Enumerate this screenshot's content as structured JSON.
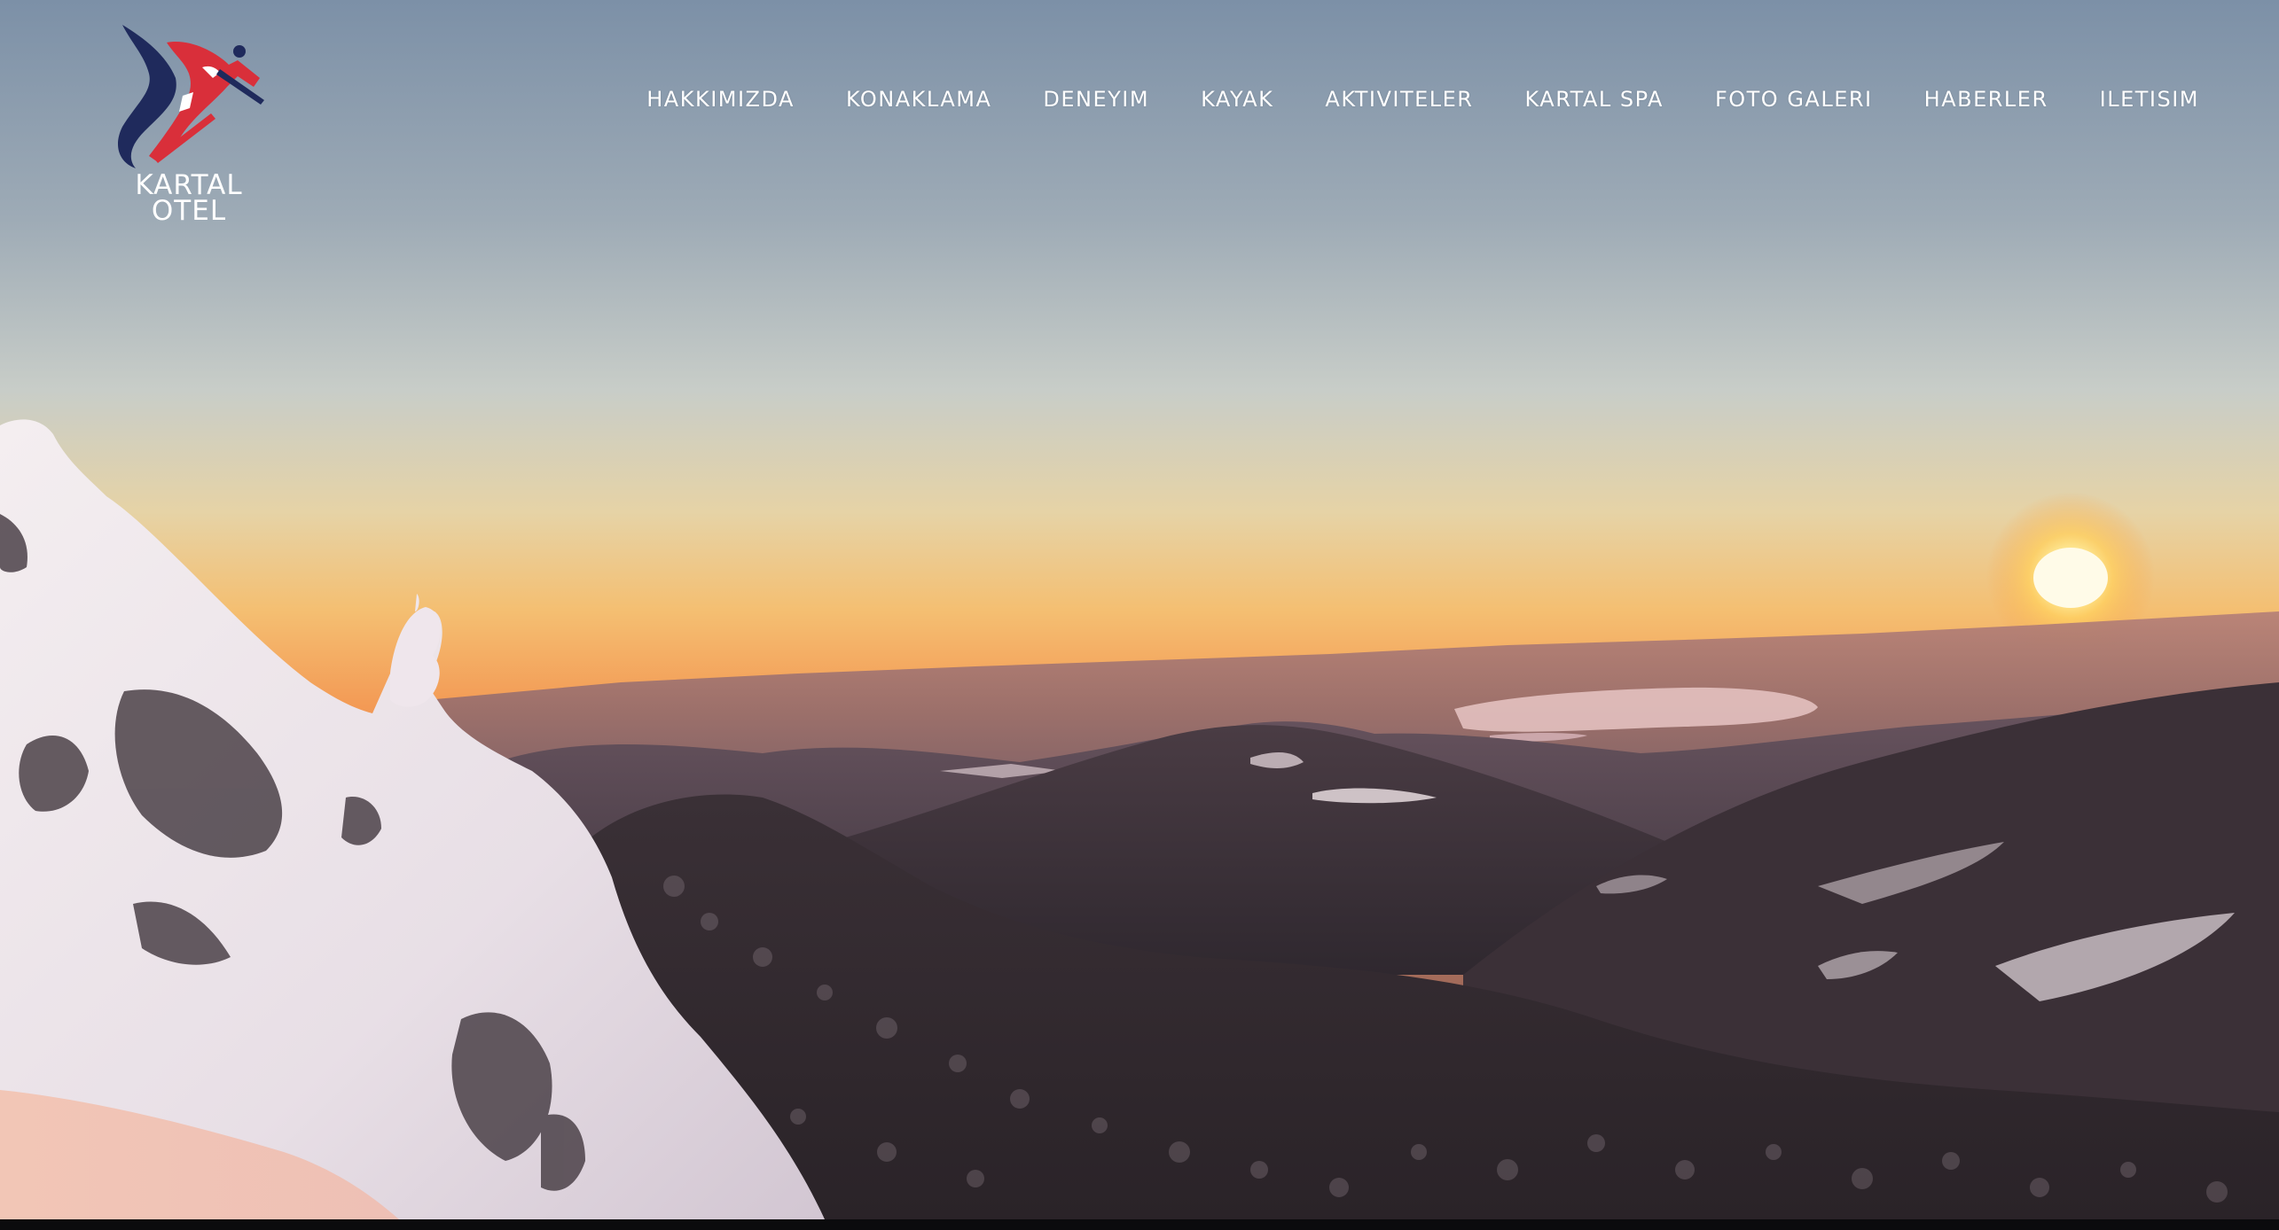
{
  "brand": {
    "name_line1": "KARTAL",
    "name_line2": "OTEL",
    "colors": {
      "red": "#d92f3a",
      "navy": "#1f2a5c",
      "white": "#ffffff"
    }
  },
  "nav": {
    "items": [
      "HAKKIMIZDA",
      "KONAKLAMA",
      "DENEYIM",
      "KAYAK",
      "AKTIVITELER",
      "KARTAL SPA",
      "FOTO GALERI",
      "HABERLER",
      "ILETISIM"
    ]
  },
  "hero": {
    "description": "",
    "sky_colors": [
      "#7e93a9",
      "#c7ccc9",
      "#f2c27b",
      "#f08a4a"
    ],
    "sun_color": "#fff3b0"
  }
}
